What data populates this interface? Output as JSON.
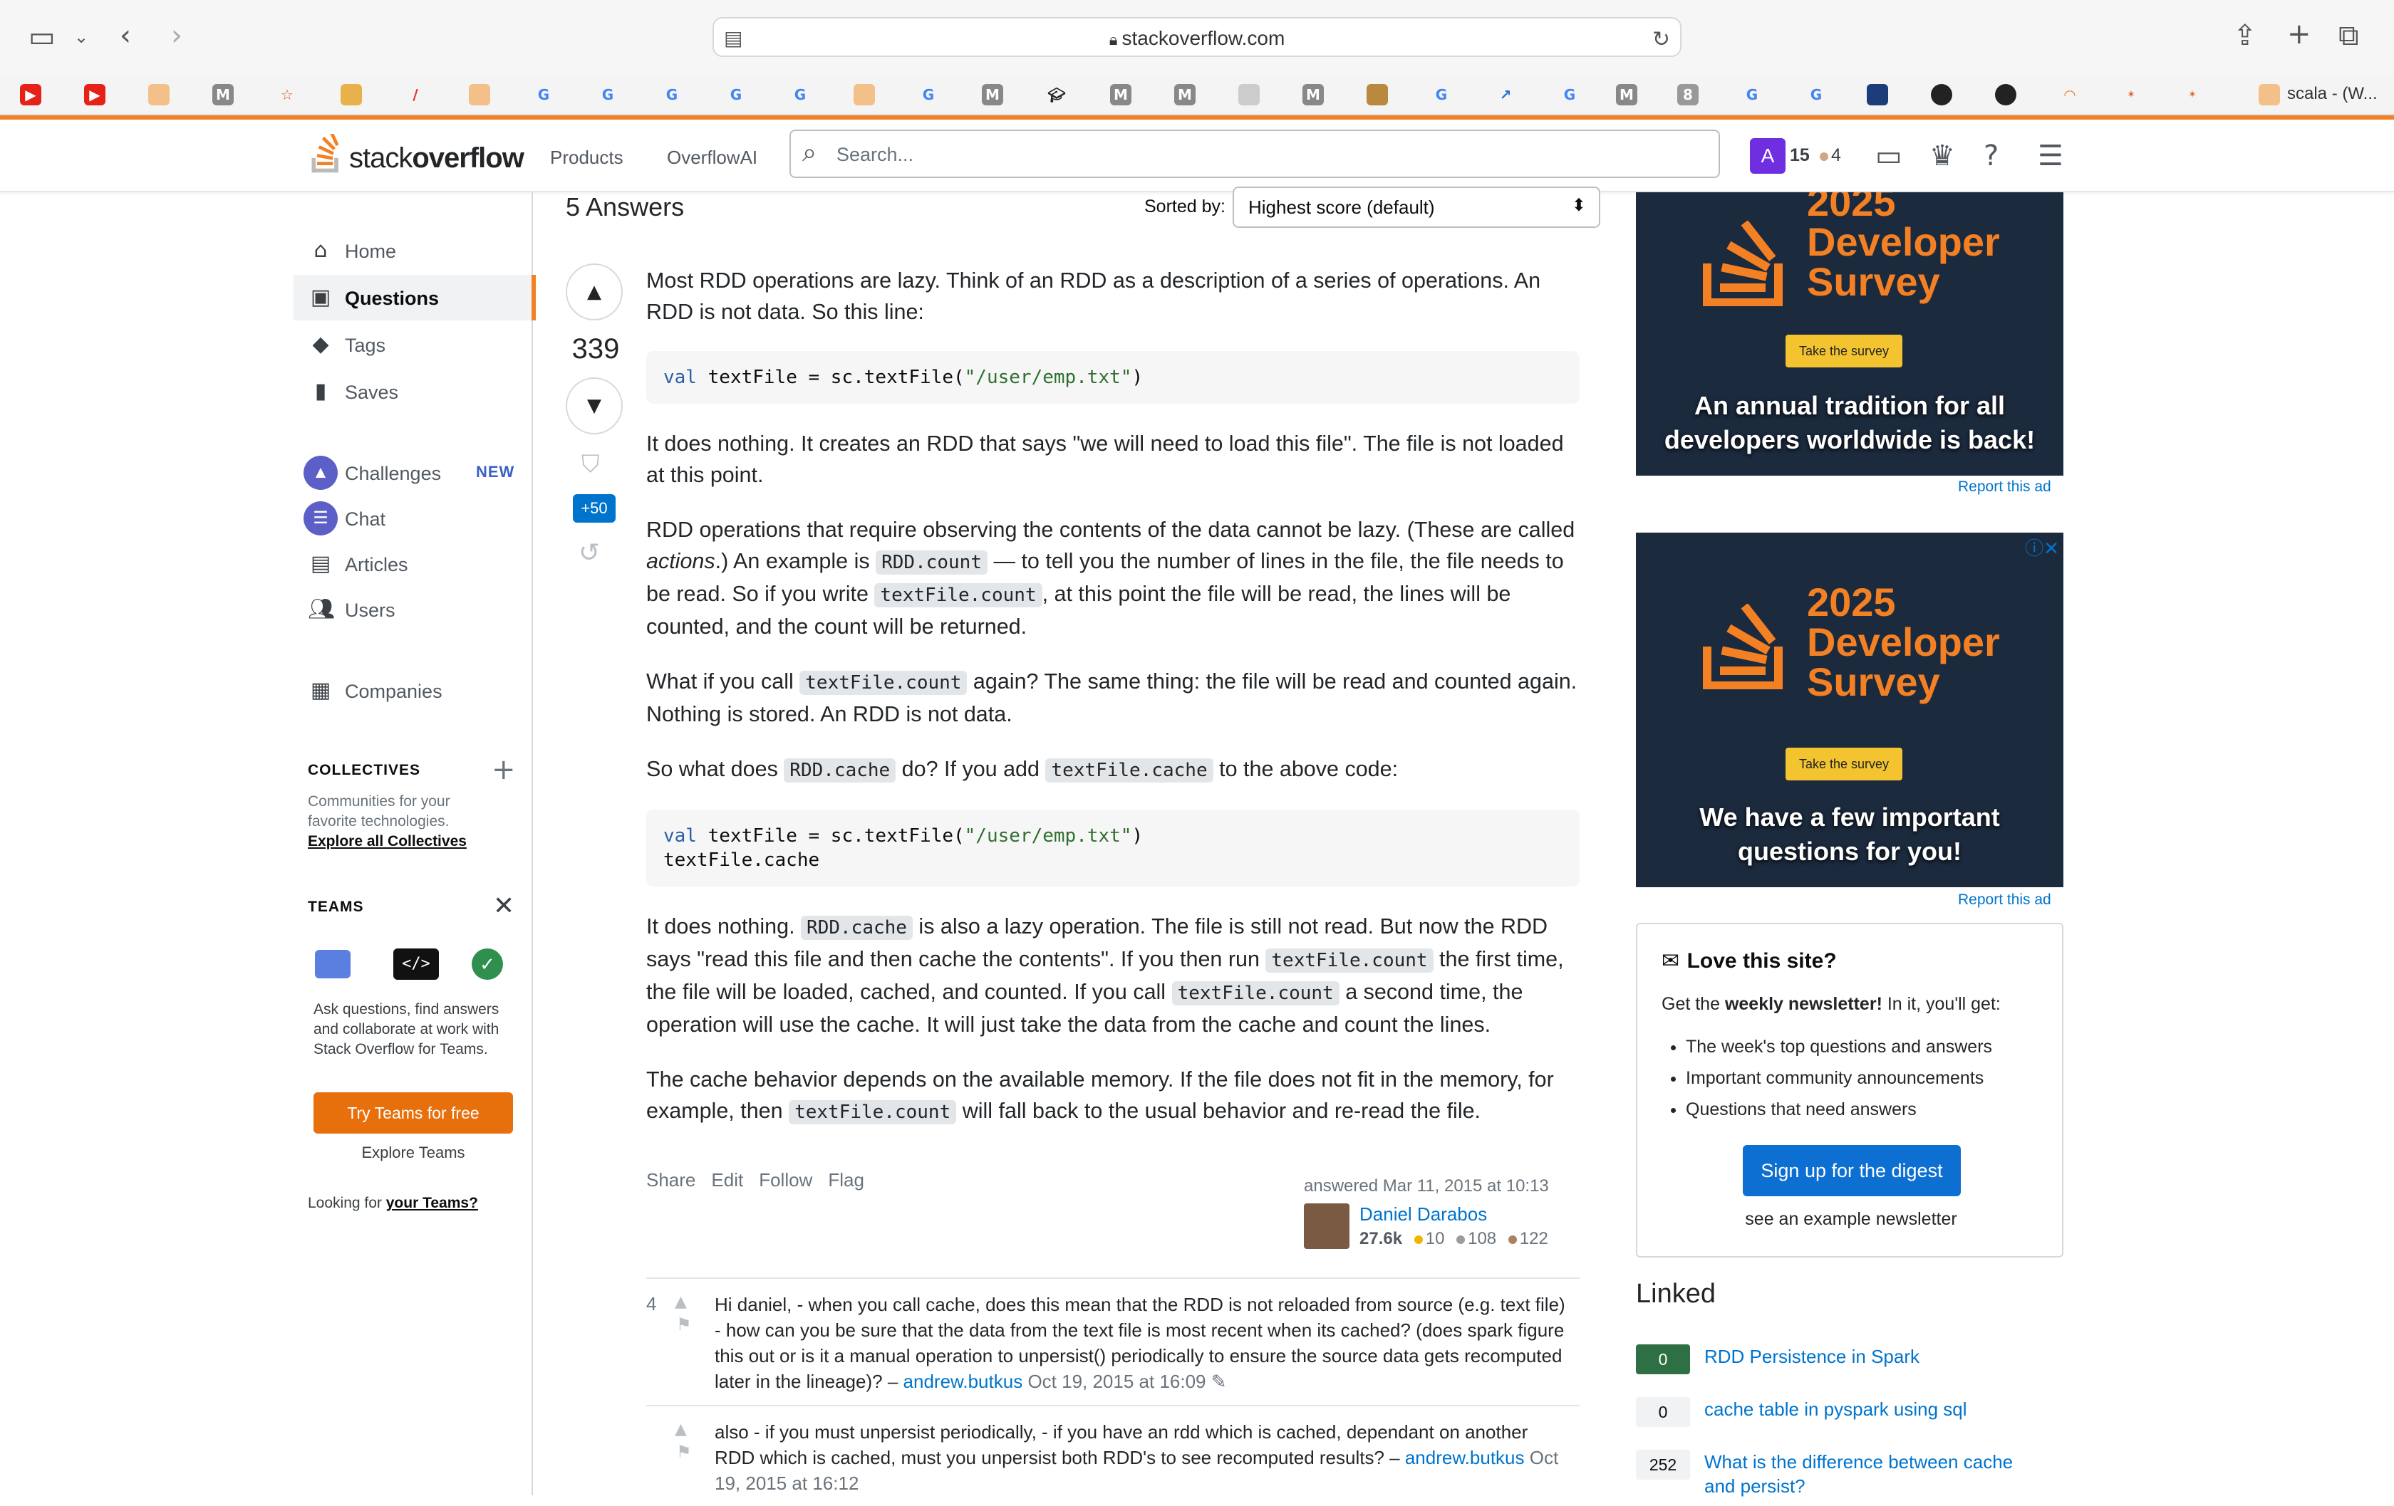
{
  "browser": {
    "url": "stackoverflow.com",
    "active_tab": "scala - (W..."
  },
  "header": {
    "logo_light": "stack",
    "logo_bold": "overflow",
    "nav": [
      "Products",
      "OverflowAI"
    ],
    "search_placeholder": "Search...",
    "avatar_letter": "A",
    "reputation": "15",
    "bronze_badges": "4"
  },
  "sidebar": {
    "items": [
      {
        "label": "Home",
        "icon": "home-icon"
      },
      {
        "label": "Questions",
        "icon": "questions-icon"
      },
      {
        "label": "Tags",
        "icon": "tag-icon"
      },
      {
        "label": "Saves",
        "icon": "bookmark-icon"
      },
      {
        "label": "Challenges",
        "icon": "challenges-icon"
      },
      {
        "label": "Chat",
        "icon": "chat-icon"
      },
      {
        "label": "Articles",
        "icon": "articles-icon"
      },
      {
        "label": "Users",
        "icon": "users-icon"
      },
      {
        "label": "Companies",
        "icon": "companies-icon"
      }
    ],
    "new_badge": "NEW",
    "collectives_heading": "COLLECTIVES",
    "collectives_desc": "Communities for your favorite technologies.",
    "collectives_link": "Explore all Collectives",
    "teams_heading": "TEAMS",
    "teams_desc": "Ask questions, find answers and collaborate at work with Stack Overflow for Teams.",
    "teams_button": "Try Teams for free",
    "teams_explore": "Explore Teams",
    "teams_looking_prefix": "Looking for ",
    "teams_looking_link": "your Teams?"
  },
  "answers": {
    "count_label": "5 Answers",
    "sorted_by_label": "Sorted by:",
    "sort_value": "Highest score (default)"
  },
  "answer": {
    "score": "339",
    "bounty": "+50",
    "p1": "Most RDD operations are lazy. Think of an RDD as a description of a series of operations. An RDD is not data. So this line:",
    "code1_kw": "val",
    "code1_rest": " textFile = sc.textFile(",
    "code1_str": "\"/user/emp.txt\"",
    "code1_end": ")",
    "p2": "It does nothing. It creates an RDD that says \"we will need to load this file\". The file is not loaded at this point.",
    "p3_a": "RDD operations that require observing the contents of the data cannot be lazy. (These are called ",
    "p3_em": "actions",
    "p3_b": ".) An example is ",
    "p3_code1": "RDD.count",
    "p3_c": " — to tell you the number of lines in the file, the file needs to be read. So if you write ",
    "p3_code2": "textFile.count",
    "p3_d": ", at this point the file will be read, the lines will be counted, and the count will be returned.",
    "p4_a": "What if you call ",
    "p4_code": "textFile.count",
    "p4_b": " again? The same thing: the file will be read and counted again. Nothing is stored. An RDD is not data.",
    "p5_a": "So what does ",
    "p5_code1": "RDD.cache",
    "p5_b": " do? If you add ",
    "p5_code2": "textFile.cache",
    "p5_c": " to the above code:",
    "code2_line2": "textFile.cache",
    "p6_a": "It does nothing. ",
    "p6_code1": "RDD.cache",
    "p6_b": " is also a lazy operation. The file is still not read. But now the RDD says \"read this file and then cache the contents\". If you then run ",
    "p6_code2": "textFile.count",
    "p6_c": " the first time, the file will be loaded, cached, and counted. If you call ",
    "p6_code3": "textFile.count",
    "p6_d": " a second time, the operation will use the cache. It will just take the data from the cache and count the lines.",
    "p7_a": "The cache behavior depends on the available memory. If the file does not fit in the memory, for example, then ",
    "p7_code": "textFile.count",
    "p7_b": " will fall back to the usual behavior and re-read the file.",
    "menu": [
      "Share",
      "Edit",
      "Follow",
      "Flag"
    ],
    "answered_time": "answered Mar 11, 2015 at 10:13",
    "author": "Daniel Darabos",
    "author_rep": "27.6k",
    "gold": "10",
    "silver": "108",
    "bronze": "122"
  },
  "comments": [
    {
      "score": "4",
      "text": "Hi daniel, - when you call cache, does this mean that the RDD is not reloaded from source (e.g. text file) - how can you be sure that the data from the text file is most recent when its cached? (does spark figure this out or is it a manual operation to unpersist() periodically to ensure the source data gets recomputed later in the lineage)? –",
      "user": "andrew.butkus",
      "time": "Oct 19, 2015 at 16:09"
    },
    {
      "score": "",
      "text": "also - if you must unpersist periodically, - if you have an rdd which is cached, dependant on another RDD which is cached, must you unpersist both RDD's to see recomputed results? –",
      "user": "andrew.butkus",
      "time": "Oct 19, 2015 at 16:12"
    }
  ],
  "ads": [
    {
      "year": "2025",
      "line1": "Developer",
      "line2": "Survey",
      "button": "Take the survey",
      "tagline1": "An annual tradition for all",
      "tagline2": "developers worldwide is back!",
      "report": "Report this ad"
    },
    {
      "year": "2025",
      "line1": "Developer",
      "line2": "Survey",
      "button": "Take the survey",
      "tagline1": "We have a few important",
      "tagline2": "questions for you!",
      "report": "Report this ad"
    }
  ],
  "newsletter": {
    "title": "Love this site?",
    "intro_a": "Get the ",
    "intro_bold": "weekly newsletter!",
    "intro_b": " In it, you'll get:",
    "items": [
      "The week's top questions and answers",
      "Important community announcements",
      "Questions that need answers"
    ],
    "button": "Sign up for the digest",
    "example": "see an example newsletter"
  },
  "linked": {
    "heading": "Linked",
    "items": [
      {
        "score": "0",
        "title": "RDD Persistence in Spark",
        "accepted": true
      },
      {
        "score": "0",
        "title": "cache table in pyspark using sql",
        "accepted": false
      },
      {
        "score": "252",
        "title": "What is the difference between cache and persist?",
        "accepted": false
      }
    ]
  },
  "colors": {
    "accent": "#f48024",
    "link": "#0074cc",
    "accepted": "#2f6f44"
  }
}
